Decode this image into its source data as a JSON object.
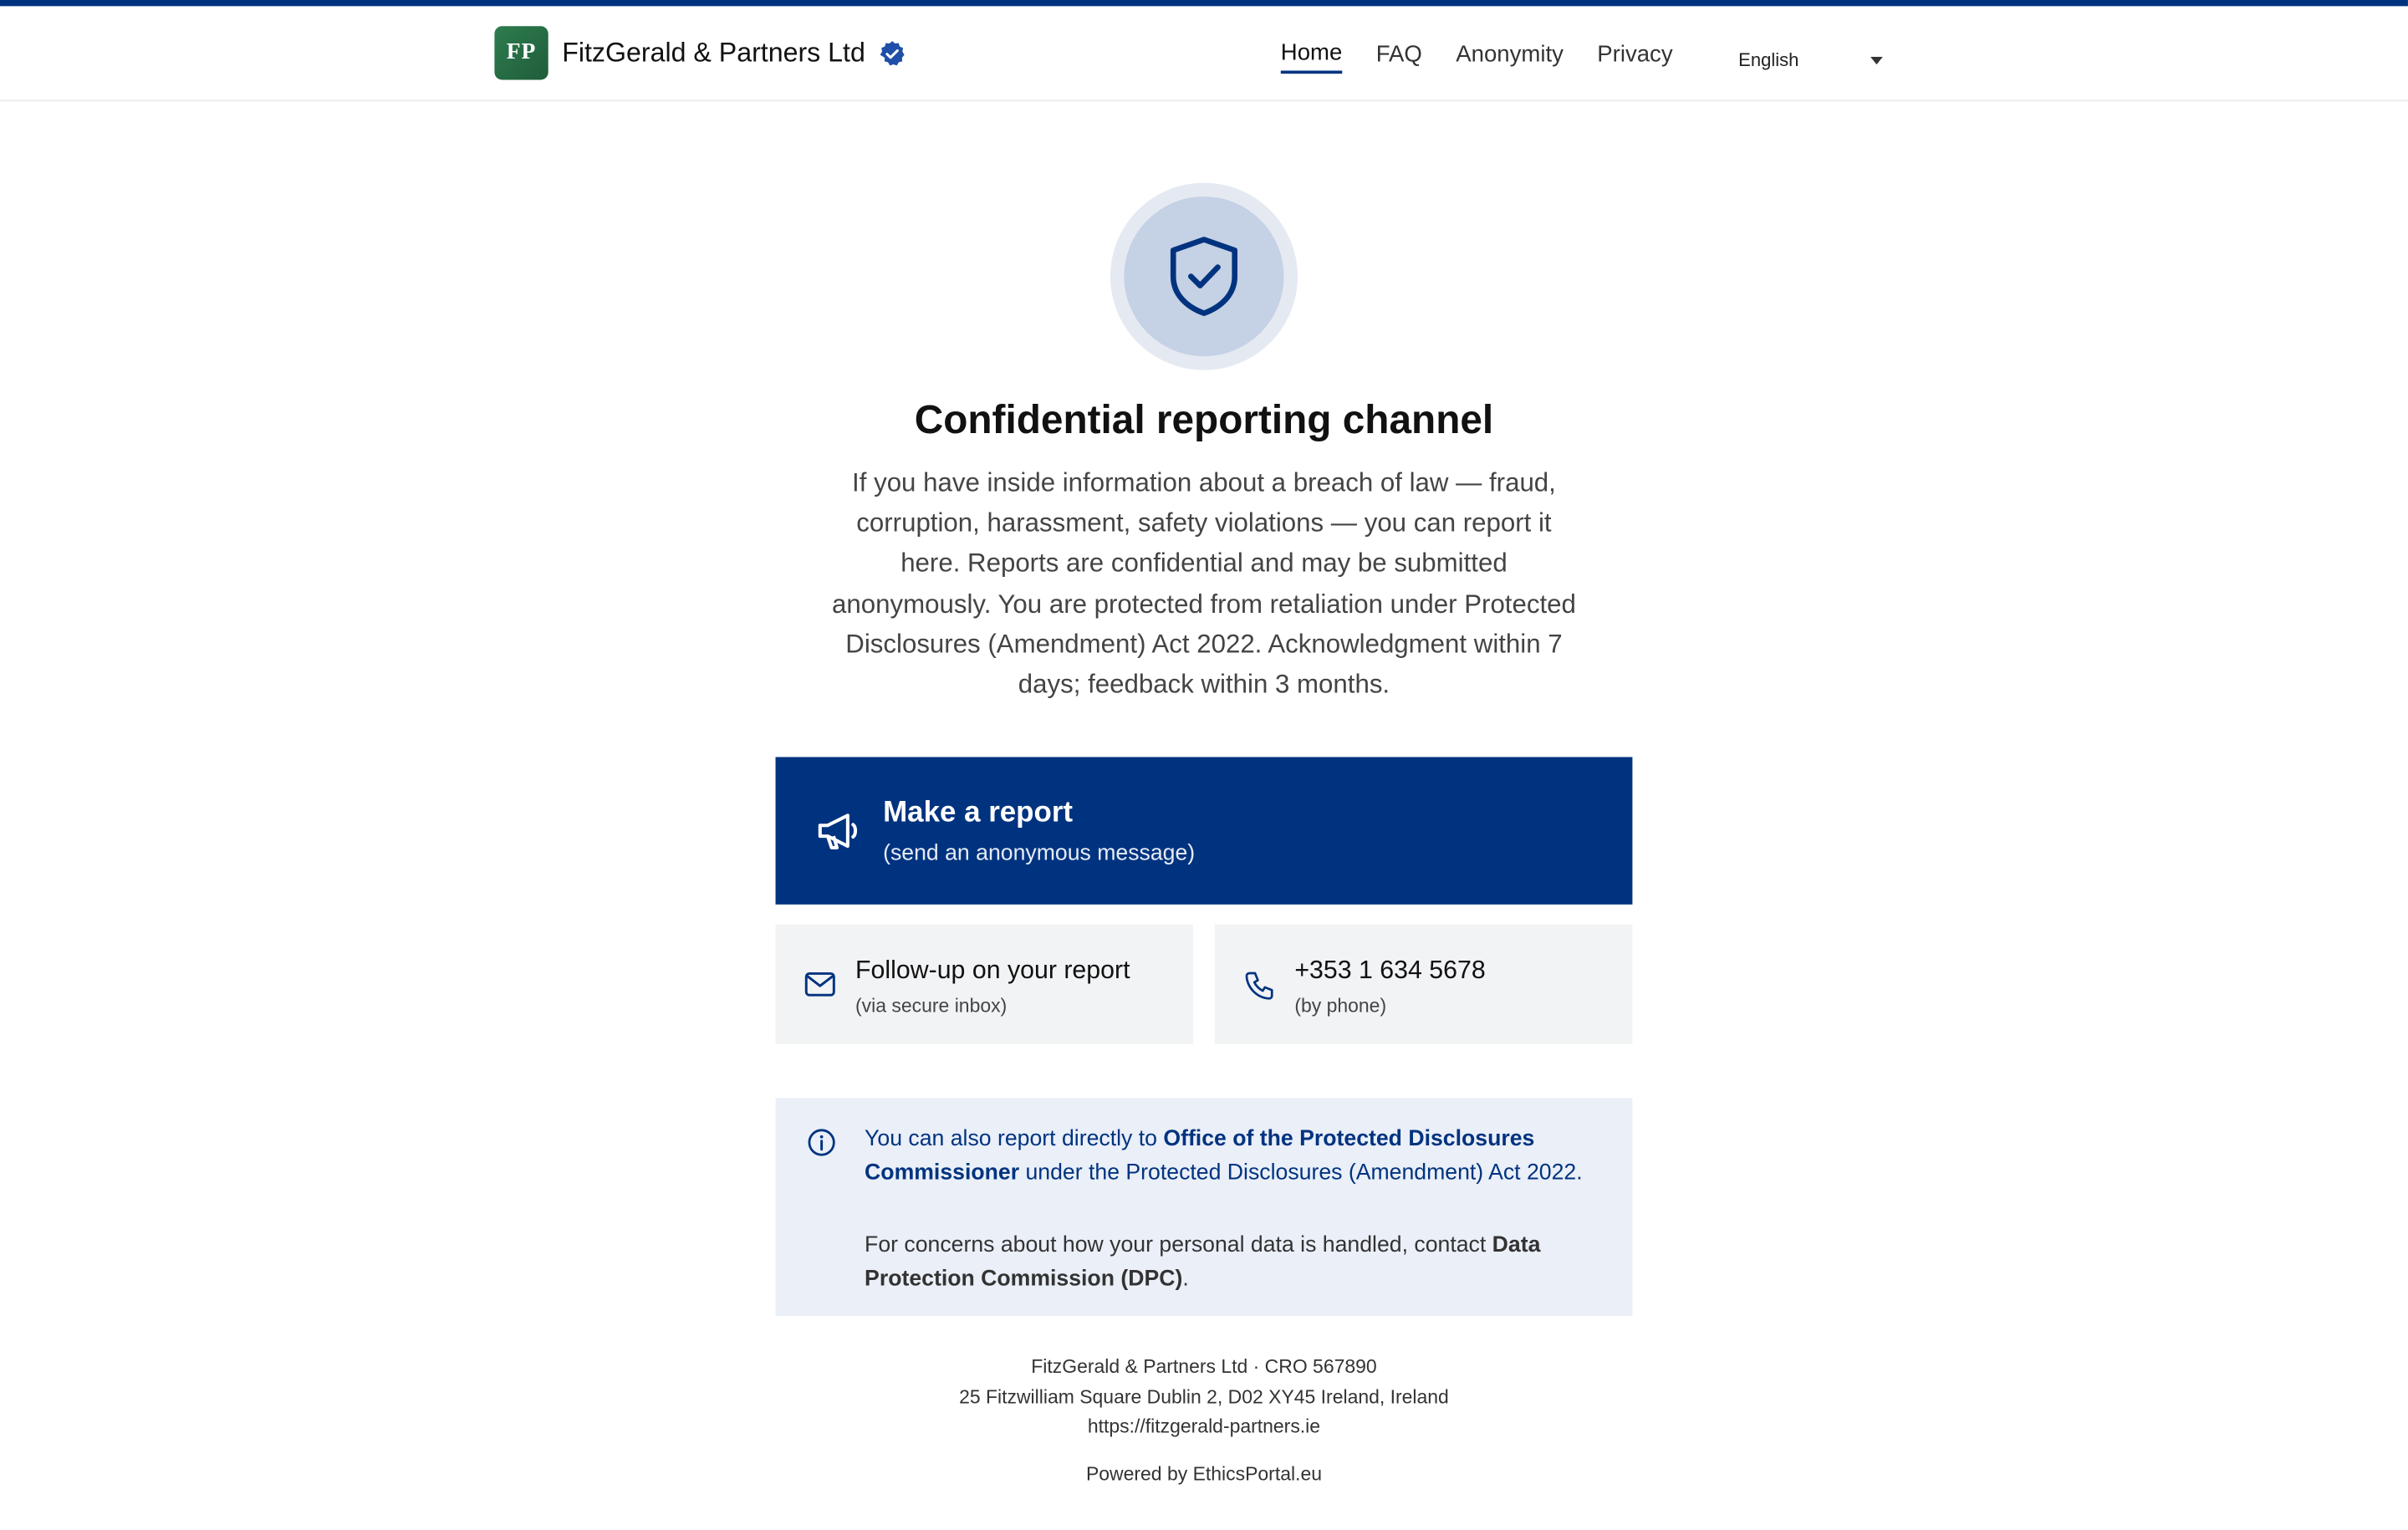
{
  "header": {
    "logo_text": "FP",
    "company_name": "FitzGerald & Partners Ltd",
    "nav": [
      {
        "label": "Home",
        "active": true
      },
      {
        "label": "FAQ",
        "active": false
      },
      {
        "label": "Anonymity",
        "active": false
      },
      {
        "label": "Privacy",
        "active": false
      }
    ],
    "language": "English"
  },
  "hero": {
    "icon": "shield-check-icon",
    "title": "Confidential reporting channel",
    "intro": "If you have inside information about a breach of law — fraud, corruption, harassment, safety violations — you can report it here. Reports are confidential and may be submitted anonymously. You are protected from retaliation under Protected Disclosures (Amendment) Act 2022. Acknowledgment within 7 days; feedback within 3 months."
  },
  "actions": {
    "primary": {
      "icon": "megaphone-icon",
      "title": "Make a report",
      "subtitle": "(send an anonymous message)"
    },
    "followup": {
      "icon": "envelope-icon",
      "title": "Follow-up on your report",
      "subtitle": "(via secure inbox)"
    },
    "phone": {
      "icon": "phone-icon",
      "title": "+353 1 634 5678",
      "subtitle": "(by phone)"
    }
  },
  "info": {
    "icon": "info-icon",
    "p1_prefix": "You can also report directly to ",
    "p1_authority": "Office of the Protected Disclosures Commissioner",
    "p1_suffix": " under the Protected Disclosures (Amendment) Act 2022.",
    "p2_prefix": "For concerns about how your personal data is handled, contact ",
    "p2_authority": "Data Protection Commission (DPC)",
    "p2_suffix": "."
  },
  "footer": {
    "company_line": "FitzGerald & Partners Ltd · CRO 567890",
    "address": "25 Fitzwilliam Square Dublin 2, D02 XY45 Ireland, Ireland",
    "website": "https://fitzgerald-partners.ie",
    "powered_by": "Powered by EthicsPortal.eu"
  },
  "colors": {
    "brand": "#00337f",
    "logo_green": "#2e7d4f",
    "info_bg": "#eaeff8",
    "card_bg": "#f2f3f5"
  }
}
